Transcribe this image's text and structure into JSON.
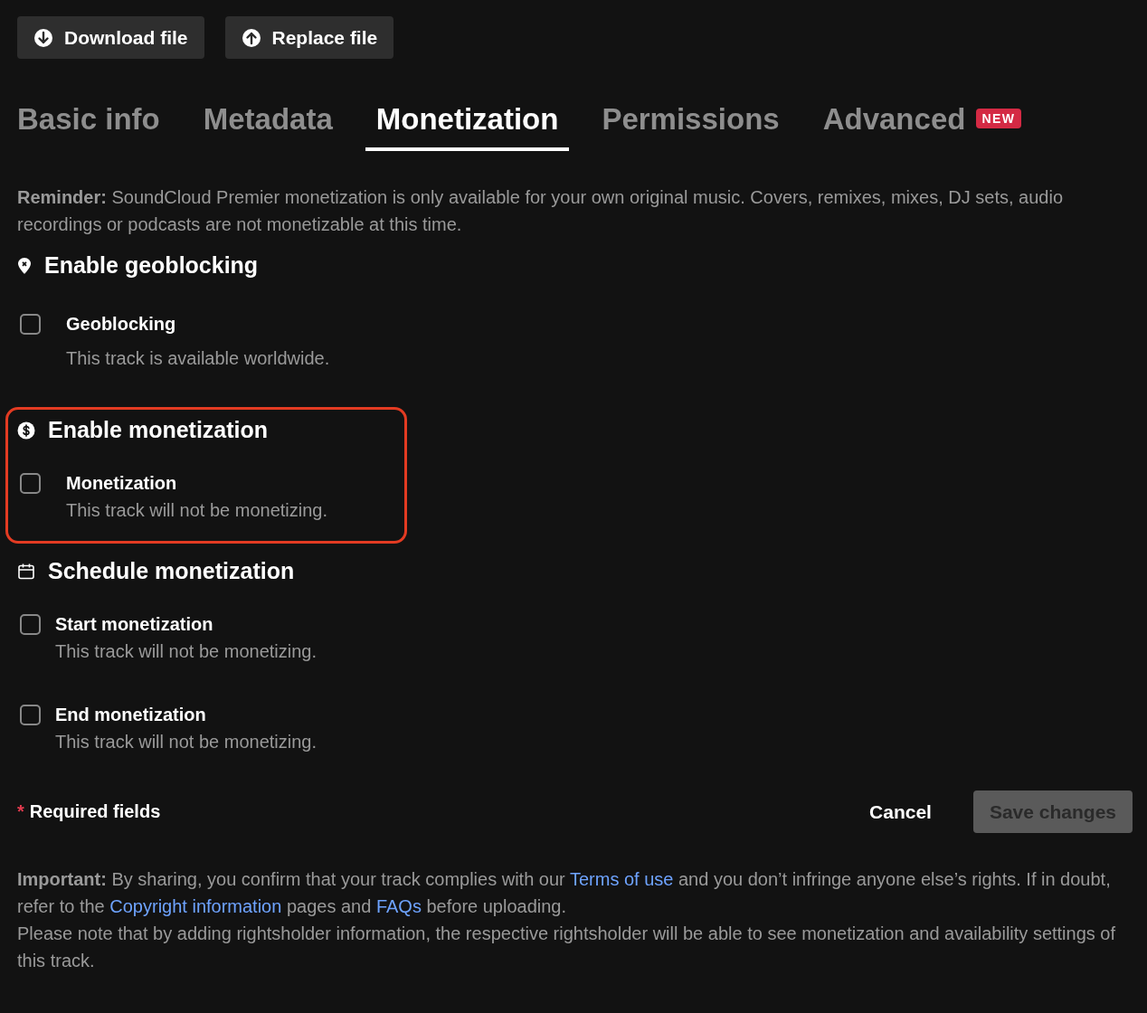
{
  "actions": [
    {
      "kind": "download",
      "label": "Download file"
    },
    {
      "kind": "upload",
      "label": "Replace file"
    }
  ],
  "tabs": [
    {
      "label": "Basic info",
      "selected": false
    },
    {
      "label": "Metadata",
      "selected": false
    },
    {
      "label": "Monetization",
      "selected": true
    },
    {
      "label": "Permissions",
      "selected": false
    },
    {
      "label": "Advanced",
      "selected": false,
      "badge": "NEW"
    }
  ],
  "reminder": "**Reminder:** SoundCloud Premier monetization is only available for your own original music. Covers, remixes, mixes, DJ sets, audio recordings or podcasts are not monetizable at this time.",
  "sections": [
    {
      "kind": "geoblocking",
      "title": "Enable geoblocking",
      "highlighted": false,
      "options": [
        {
          "label": "Geoblocking",
          "description": "This track is available worldwide.",
          "checked": false
        }
      ]
    },
    {
      "kind": "monetization",
      "title": "Enable monetization",
      "highlighted": true,
      "options": [
        {
          "label": "Monetization",
          "description": "This track will not be monetizing.",
          "checked": false
        }
      ]
    },
    {
      "kind": "schedule",
      "title": "Schedule monetization",
      "highlighted": false,
      "options": [
        {
          "label": "Start monetization",
          "description": "This track will not be monetizing.",
          "checked": false
        },
        {
          "label": "End monetization",
          "description": "This track will not be monetizing.",
          "checked": false
        }
      ]
    }
  ],
  "footer": {
    "required_mark": "*",
    "required_label": "Required fields",
    "cancel": "Cancel",
    "save": {
      "label": "Save changes",
      "disabled": true
    }
  },
  "notice": [
    [
      {
        "kind": "text",
        "text": "**Important:** By sharing, you confirm that your track complies with our "
      },
      {
        "kind": "link",
        "text": "Terms of use"
      },
      {
        "kind": "text",
        "text": " and you don’t infringe anyone else’s rights. If in doubt, refer to the "
      },
      {
        "kind": "link",
        "text": "Copyright information"
      },
      {
        "kind": "text",
        "text": " pages and "
      },
      {
        "kind": "link",
        "text": "FAQs"
      },
      {
        "kind": "text",
        "text": " before uploading."
      }
    ],
    [
      {
        "kind": "text",
        "text": "Please note that by adding rightsholder information, the respective rightsholder will be able to see monetization and availability settings of this track."
      }
    ]
  ]
}
